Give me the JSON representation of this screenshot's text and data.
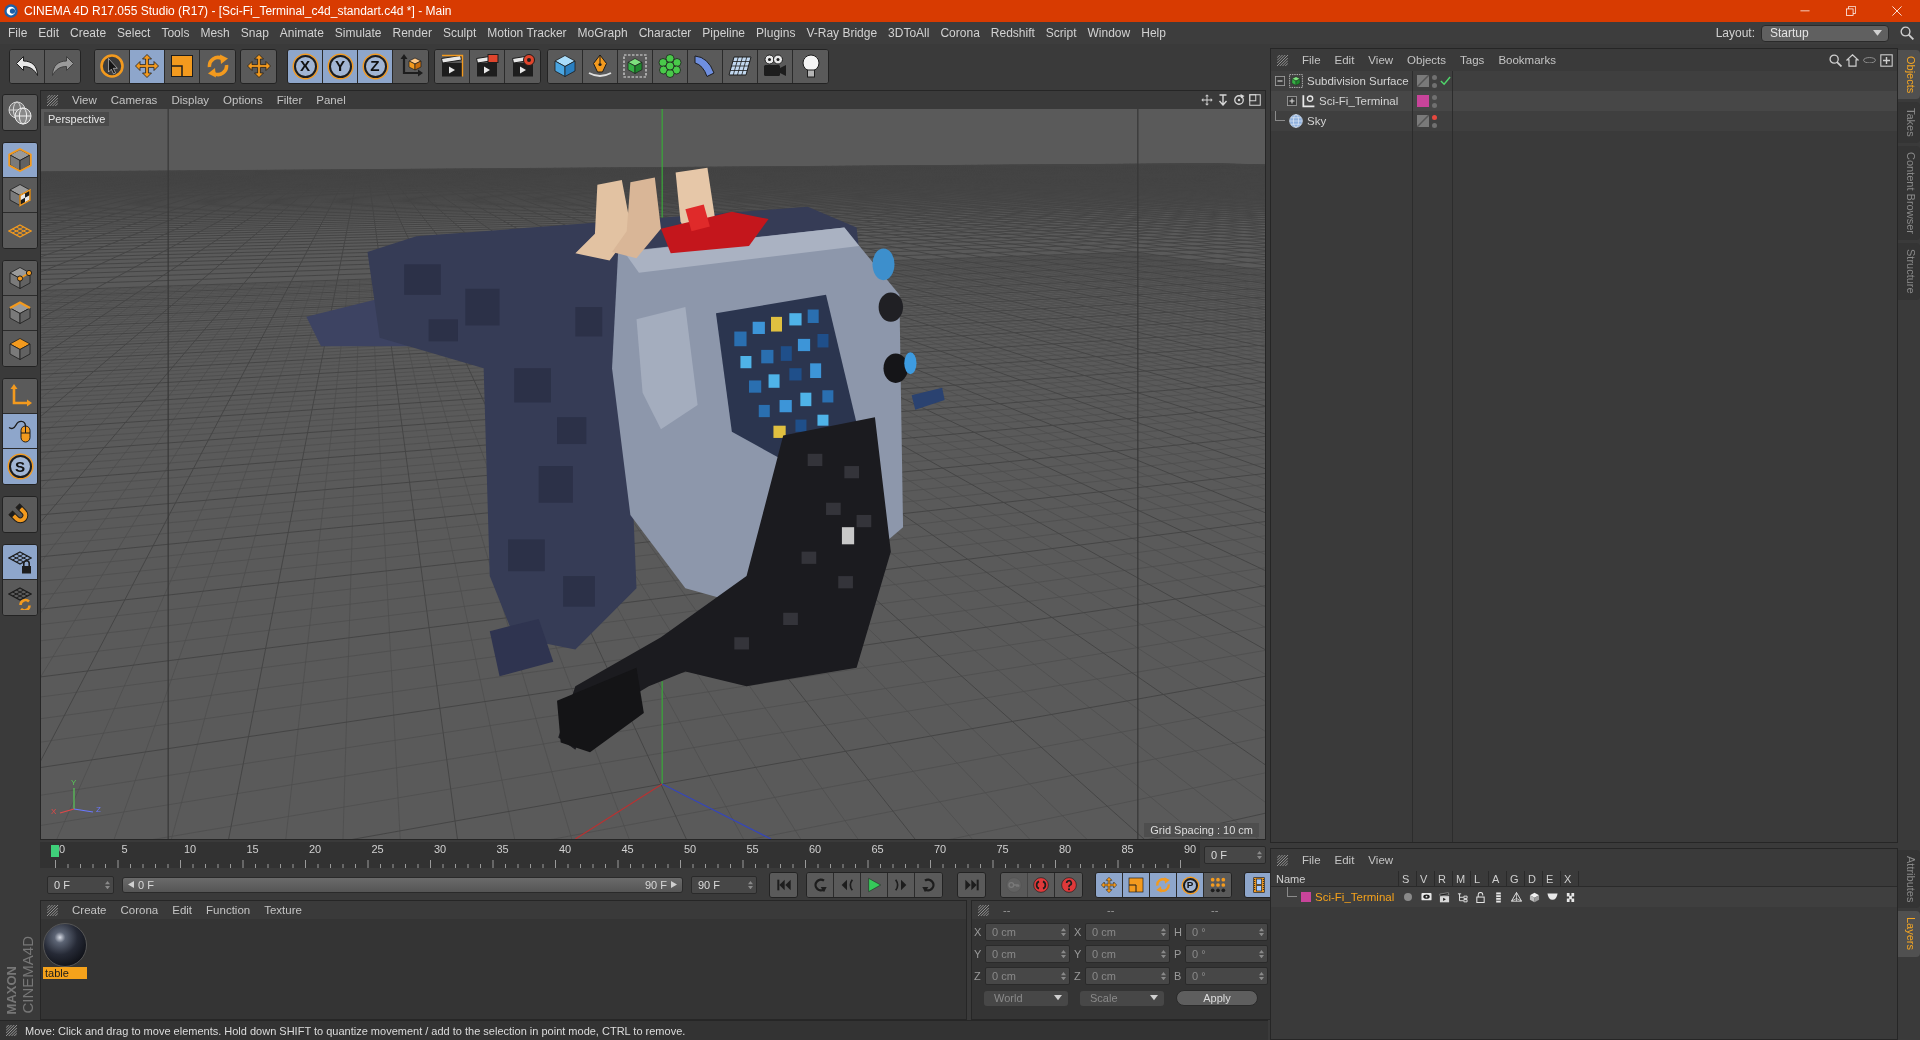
{
  "window": {
    "title": "CINEMA 4D R17.055 Studio (R17) - [Sci-Fi_Terminal_c4d_standart.c4d *] - Main"
  },
  "menu": [
    "File",
    "Edit",
    "Create",
    "Select",
    "Tools",
    "Mesh",
    "Snap",
    "Animate",
    "Simulate",
    "Render",
    "Sculpt",
    "Motion Tracker",
    "MoGraph",
    "Character",
    "Pipeline",
    "Plugins",
    "V-Ray Bridge",
    "3DToAll",
    "Corona",
    "Redshift",
    "Script",
    "Window",
    "Help"
  ],
  "layout": {
    "label": "Layout:",
    "value": "Startup"
  },
  "toolbar": [
    {
      "tools": [
        {
          "kind": "undo",
          "disabled": false
        },
        {
          "kind": "redo",
          "disabled": true
        }
      ]
    },
    {
      "tools": [
        {
          "kind": "select",
          "selected": false
        },
        {
          "kind": "move",
          "selected": true
        },
        {
          "kind": "scale",
          "selected": false
        },
        {
          "kind": "rotate",
          "selected": false
        }
      ]
    },
    {
      "tools": [
        {
          "kind": "live",
          "selected": false
        }
      ]
    },
    {
      "tools": [
        {
          "kind": "axis_lock",
          "label": "X",
          "selected": true
        },
        {
          "kind": "axis_lock",
          "label": "Y",
          "selected": true
        },
        {
          "kind": "axis_lock",
          "label": "Z",
          "selected": true
        },
        {
          "kind": "world",
          "selected": false
        }
      ]
    },
    {
      "tools": [
        {
          "kind": "render_view"
        },
        {
          "kind": "render_pv"
        },
        {
          "kind": "render_settings"
        }
      ]
    },
    {
      "tools": [
        {
          "kind": "cube"
        },
        {
          "kind": "pen"
        },
        {
          "kind": "subdiv"
        },
        {
          "kind": "cloner"
        },
        {
          "kind": "bend"
        },
        {
          "kind": "floor"
        },
        {
          "kind": "camera"
        },
        {
          "kind": "light"
        }
      ]
    }
  ],
  "palette": [
    {
      "tools": [
        {
          "kind": "globe"
        }
      ]
    },
    {
      "tools": [
        {
          "kind": "model",
          "selected": true
        },
        {
          "kind": "texture",
          "selected": false
        },
        {
          "kind": "workplane",
          "selected": false
        }
      ]
    },
    {
      "tools": [
        {
          "kind": "points",
          "selected": false
        },
        {
          "kind": "edges",
          "selected": false
        },
        {
          "kind": "polygons",
          "selected": false
        }
      ]
    },
    {
      "tools": [
        {
          "kind": "axis",
          "selected": false
        },
        {
          "kind": "tweak",
          "selected": true
        },
        {
          "kind": "snap",
          "label": "S",
          "selected": true
        }
      ]
    },
    {
      "tools": [
        {
          "kind": "magnet",
          "selected": false
        }
      ]
    },
    {
      "tools": [
        {
          "kind": "wp_lock",
          "selected": true
        },
        {
          "kind": "wp_rotate",
          "selected": false
        }
      ]
    }
  ],
  "logo": {
    "brand": "MAXON",
    "product": "CINEMA4D"
  },
  "viewport": {
    "menu": [
      "View",
      "Cameras",
      "Display",
      "Options",
      "Filter",
      "Panel"
    ],
    "camera": "Perspective",
    "grid_spacing": "Grid Spacing : 10 cm",
    "axis_labels": [
      "Y",
      "X",
      "Z"
    ]
  },
  "timeline": {
    "ticks": [
      "0",
      "5",
      "10",
      "15",
      "20",
      "25",
      "30",
      "35",
      "40",
      "45",
      "50",
      "55",
      "60",
      "65",
      "70",
      "75",
      "80",
      "85",
      "90"
    ],
    "level": 0,
    "frame": "0 F"
  },
  "transport": {
    "start": "0 F",
    "range": {
      "from": "0 F",
      "to": "90 F",
      "level": 1
    },
    "end": "90 F",
    "groups": [
      {
        "tools": [
          {
            "kind": "first"
          }
        ]
      },
      {
        "tools": [
          {
            "kind": "prev_key"
          },
          {
            "kind": "prev"
          },
          {
            "kind": "play"
          },
          {
            "kind": "next"
          },
          {
            "kind": "next_key"
          }
        ]
      },
      {
        "tools": [
          {
            "kind": "last"
          }
        ]
      },
      {
        "tools": [
          {
            "kind": "key",
            "disabled": true
          },
          {
            "kind": "record",
            "disabled": false
          },
          {
            "kind": "help",
            "disabled": false
          }
        ]
      },
      {
        "tools": [
          {
            "kind": "pos_key",
            "selected": true
          },
          {
            "kind": "scale_key",
            "selected": true
          },
          {
            "kind": "rot_key",
            "selected": true
          },
          {
            "kind": "param",
            "label": "P",
            "selected": true
          },
          {
            "kind": "dots",
            "selected": false
          }
        ]
      },
      {
        "tools": [
          {
            "kind": "film",
            "selected": true
          }
        ]
      }
    ]
  },
  "materials": {
    "menu": [
      "Create",
      "Corona",
      "Edit",
      "Function",
      "Texture"
    ],
    "items": [
      {
        "name": "table",
        "selected": true
      }
    ]
  },
  "coordinates": {
    "disabled": true,
    "headers": [
      "--",
      "--",
      "--"
    ],
    "rows": [
      {
        "cells": [
          {
            "label": "X",
            "value": "0 cm"
          },
          {
            "label": "X",
            "value": "0 cm"
          },
          {
            "label": "H",
            "value": "0 °"
          }
        ]
      },
      {
        "cells": [
          {
            "label": "Y",
            "value": "0 cm"
          },
          {
            "label": "Y",
            "value": "0 cm"
          },
          {
            "label": "P",
            "value": "0 °"
          }
        ]
      },
      {
        "cells": [
          {
            "label": "Z",
            "value": "0 cm"
          },
          {
            "label": "Z",
            "value": "0 cm"
          },
          {
            "label": "B",
            "value": "0 °"
          }
        ]
      }
    ],
    "space": "World",
    "mode": "Scale",
    "apply": "Apply"
  },
  "status_bar": {
    "text": "Move: Click and drag to move elements. Hold down SHIFT to quantize movement / add to the selection in point mode, CTRL to remove."
  },
  "objects": {
    "menu": [
      "File",
      "Edit",
      "View",
      "Objects",
      "Tags",
      "Bookmarks"
    ],
    "items": [
      {
        "name": "Subdivision Surface",
        "kind": "subdivision",
        "selected": false,
        "expanded": true,
        "enabled": true,
        "dots": [
          {
            "color": "#707070"
          },
          {
            "color": "#707070"
          }
        ],
        "children": [
          {
            "name": "Sci-Fi_Terminal",
            "kind": "null",
            "selected": false,
            "expanded": false,
            "color": "#c8449a",
            "dots": [
              {
                "color": "#707070"
              },
              {
                "color": "#707070"
              }
            ]
          }
        ]
      },
      {
        "name": "Sky",
        "kind": "sky",
        "selected": false,
        "dots": [
          {
            "color": "#e5483f"
          },
          {
            "color": "#707070"
          }
        ]
      }
    ]
  },
  "layers": {
    "menu": [
      "File",
      "Edit",
      "View"
    ],
    "columns": [
      "Name",
      "S",
      "V",
      "R",
      "M",
      "L",
      "A",
      "G",
      "D",
      "E",
      "X"
    ],
    "items": [
      {
        "name": "Sci-Fi_Terminal",
        "color": "#c8449a",
        "selected": true,
        "solo": false,
        "locked": false
      }
    ]
  },
  "tabs": {
    "top": [
      {
        "label": "Objects",
        "selected": true
      },
      {
        "label": "Takes",
        "selected": false
      },
      {
        "label": "Content Browser",
        "selected": false
      },
      {
        "label": "Structure",
        "selected": false
      }
    ],
    "bottom": [
      {
        "label": "Attributes",
        "selected": false
      },
      {
        "label": "Layers",
        "selected": true
      }
    ]
  }
}
